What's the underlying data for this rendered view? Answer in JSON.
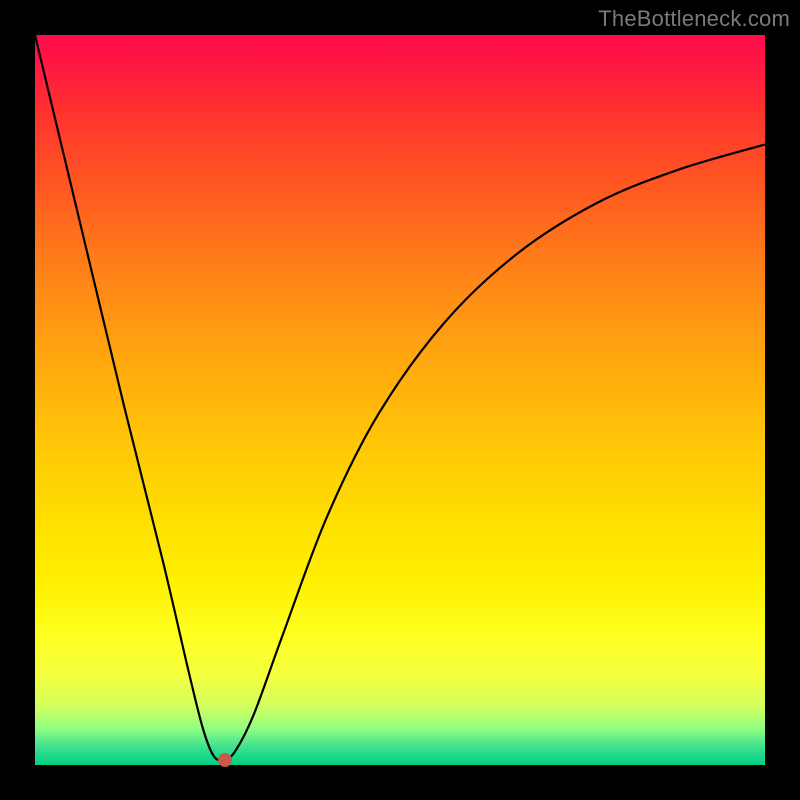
{
  "watermark": "TheBottleneck.com",
  "chart_data": {
    "type": "line",
    "title": "",
    "xlabel": "",
    "ylabel": "",
    "xlim": [
      0,
      1
    ],
    "ylim": [
      0,
      1
    ],
    "minimum": {
      "x": 0.26,
      "y": 0.993
    },
    "dot_color": "#c85a4a",
    "gradient_stops": [
      {
        "pos": 0.0,
        "color": "#ff0a4a"
      },
      {
        "pos": 0.1,
        "color": "#ff3030"
      },
      {
        "pos": 0.3,
        "color": "#ff7a1a"
      },
      {
        "pos": 0.55,
        "color": "#ffc408"
      },
      {
        "pos": 0.75,
        "color": "#fff000"
      },
      {
        "pos": 0.92,
        "color": "#d0ff60"
      },
      {
        "pos": 1.0,
        "color": "#00d084"
      }
    ],
    "series": [
      {
        "name": "bottleneck-curve",
        "points": [
          {
            "x": 0.0,
            "y": 0.0
          },
          {
            "x": 0.06,
            "y": 0.25
          },
          {
            "x": 0.12,
            "y": 0.5
          },
          {
            "x": 0.175,
            "y": 0.72
          },
          {
            "x": 0.21,
            "y": 0.87
          },
          {
            "x": 0.23,
            "y": 0.95
          },
          {
            "x": 0.245,
            "y": 0.988
          },
          {
            "x": 0.26,
            "y": 0.993
          },
          {
            "x": 0.275,
            "y": 0.98
          },
          {
            "x": 0.3,
            "y": 0.93
          },
          {
            "x": 0.34,
            "y": 0.82
          },
          {
            "x": 0.4,
            "y": 0.66
          },
          {
            "x": 0.47,
            "y": 0.52
          },
          {
            "x": 0.56,
            "y": 0.395
          },
          {
            "x": 0.66,
            "y": 0.3
          },
          {
            "x": 0.77,
            "y": 0.23
          },
          {
            "x": 0.88,
            "y": 0.185
          },
          {
            "x": 1.0,
            "y": 0.15
          }
        ]
      }
    ]
  }
}
